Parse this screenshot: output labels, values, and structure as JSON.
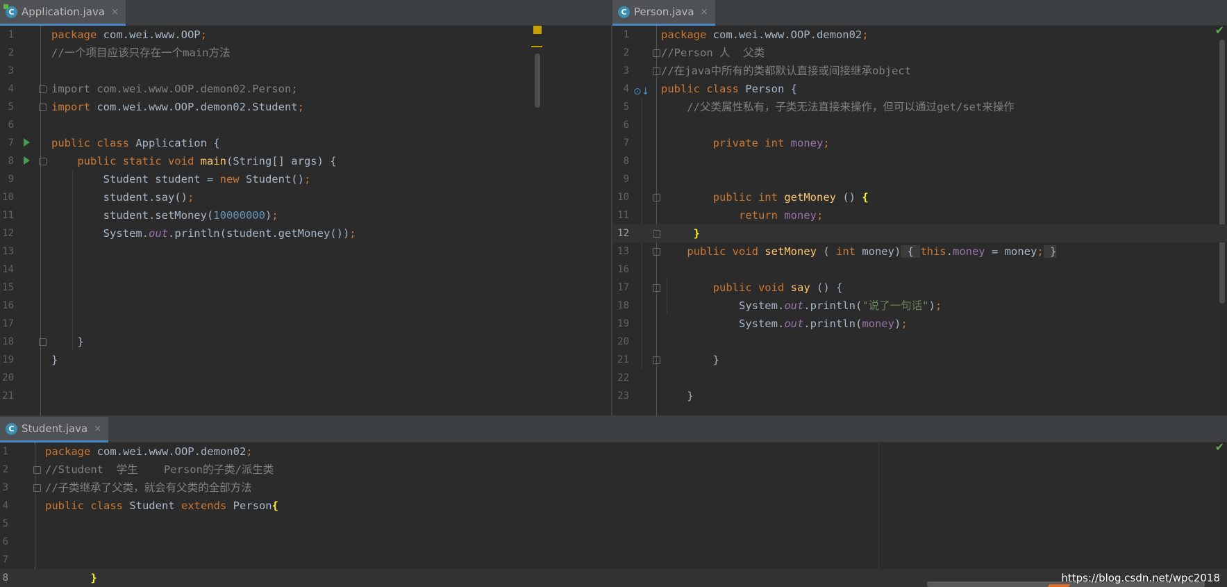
{
  "left_pane": {
    "tab": {
      "title": "Application.java",
      "icon": "java-class-runnable-icon",
      "close": "×"
    },
    "lines": [
      {
        "no": "1",
        "html": "<span class=\"k\">package</span> com.wei.www.OOP<span class=\"k\">;</span>"
      },
      {
        "no": "2",
        "html": "<span class=\"c\">//一个项目应该只存在一个main方法</span>"
      },
      {
        "no": "3",
        "html": ""
      },
      {
        "no": "4",
        "html": "<span class=\"imp\">import com.wei.www.OOP.demon02.Person;</span>"
      },
      {
        "no": "5",
        "html": "<span class=\"k\">import</span> com.wei.www.OOP.demon02.Student<span class=\"k\">;</span>"
      },
      {
        "no": "6",
        "html": ""
      },
      {
        "no": "7",
        "html": "<span class=\"k\">public class</span> Application {"
      },
      {
        "no": "8",
        "html": "    <span class=\"k\">public static void</span> <span class=\"m\">main</span>(String[] args) {"
      },
      {
        "no": "9",
        "html": "        Student student = <span class=\"k\">new</span> Student()<span class=\"k\">;</span>"
      },
      {
        "no": "10",
        "html": "        student.say()<span class=\"k\">;</span>"
      },
      {
        "no": "11",
        "html": "        student.setMoney(<span class=\"n\">10000000</span>)<span class=\"k\">;</span>"
      },
      {
        "no": "12",
        "html": "        System.<span class=\"st\">out</span>.println(student.getMoney())<span class=\"k\">;</span>"
      },
      {
        "no": "13",
        "html": ""
      },
      {
        "no": "14",
        "html": ""
      },
      {
        "no": "15",
        "html": ""
      },
      {
        "no": "16",
        "html": ""
      },
      {
        "no": "17",
        "html": ""
      },
      {
        "no": "18",
        "html": "    }"
      },
      {
        "no": "19",
        "html": "}"
      },
      {
        "no": "20",
        "html": ""
      },
      {
        "no": "21",
        "html": ""
      }
    ]
  },
  "right_pane": {
    "tab": {
      "title": "Person.java",
      "icon": "java-class-icon",
      "close": "×"
    },
    "lines": [
      {
        "no": "1",
        "html": "<span class=\"k\">package</span> com.wei.www.OOP.demon02<span class=\"k\">;</span>"
      },
      {
        "no": "2",
        "html": "<span class=\"c\">//Person 人  父类</span>"
      },
      {
        "no": "3",
        "html": "<span class=\"c\">//在java中所有的类都默认直接或间接继承object</span>"
      },
      {
        "no": "4",
        "html": "<span class=\"k\">public class</span> Person {"
      },
      {
        "no": "5",
        "html": "    <span class=\"c\">//父类属性私有，子类无法直接来操作，但可以通过get/set来操作</span>"
      },
      {
        "no": "6",
        "html": ""
      },
      {
        "no": "7",
        "html": "        <span class=\"k\">private int</span> <span class=\"f\">money</span><span class=\"k\">;</span>"
      },
      {
        "no": "8",
        "html": ""
      },
      {
        "no": "9",
        "html": ""
      },
      {
        "no": "10",
        "html": "        <span class=\"k\">public int</span> <span class=\"m\">getMoney</span> () <span class=\"br\">{</span>"
      },
      {
        "no": "11",
        "html": "            <span class=\"k\">return</span> <span class=\"f\">money</span><span class=\"k\">;</span>"
      },
      {
        "no": "12",
        "html": "     <span class=\"br\">}</span>",
        "current": true
      },
      {
        "no": "13",
        "html": "    <span class=\"k\">public void</span> <span class=\"m\">setMoney</span> ( <span class=\"k\">int</span> money)<span class=\"hint\"> { </span><span class=\"k\">this</span>.<span class=\"f\">money</span> = money<span class=\"k\">;</span><span class=\"hint\"> }</span>"
      },
      {
        "no": "16",
        "html": ""
      },
      {
        "no": "17",
        "html": "        <span class=\"k\">public void</span> <span class=\"m\">say</span> () {"
      },
      {
        "no": "18",
        "html": "            System.<span class=\"st\">out</span>.println(<span class=\"s\">\"说了一句话\"</span>)<span class=\"k\">;</span>"
      },
      {
        "no": "19",
        "html": "            System.<span class=\"st\">out</span>.println(<span class=\"f\">money</span>)<span class=\"k\">;</span>"
      },
      {
        "no": "20",
        "html": ""
      },
      {
        "no": "21",
        "html": "        }"
      },
      {
        "no": "22",
        "html": ""
      },
      {
        "no": "23",
        "html": "    }"
      }
    ]
  },
  "bottom_pane": {
    "tab": {
      "title": "Student.java",
      "icon": "java-class-icon",
      "close": "×"
    },
    "lines": [
      {
        "no": "1",
        "html": "<span class=\"k\">package</span> com.wei.www.OOP.demon02<span class=\"k\">;</span>"
      },
      {
        "no": "2",
        "html": "<span class=\"c\">//Student  学生    Person的子类/派生类</span>"
      },
      {
        "no": "3",
        "html": "<span class=\"c\">//子类继承了父类，就会有父类的全部方法</span>"
      },
      {
        "no": "4",
        "html": "<span class=\"k\">public class</span> Student <span class=\"k\">extends</span> Person<span class=\"br\">{</span>"
      },
      {
        "no": "5",
        "html": ""
      },
      {
        "no": "6",
        "html": ""
      },
      {
        "no": "7",
        "html": ""
      },
      {
        "no": "8",
        "html": "       <span class=\"br\">}</span>",
        "current": true
      }
    ]
  },
  "watermark": "https://blog.csdn.net/wpc2018",
  "colors": {
    "keyword": "#cc7832",
    "comment": "#808080",
    "field": "#9876aa",
    "number": "#6897bb",
    "method": "#ffc66d",
    "string": "#6a8759",
    "background": "#2b2b2b"
  }
}
